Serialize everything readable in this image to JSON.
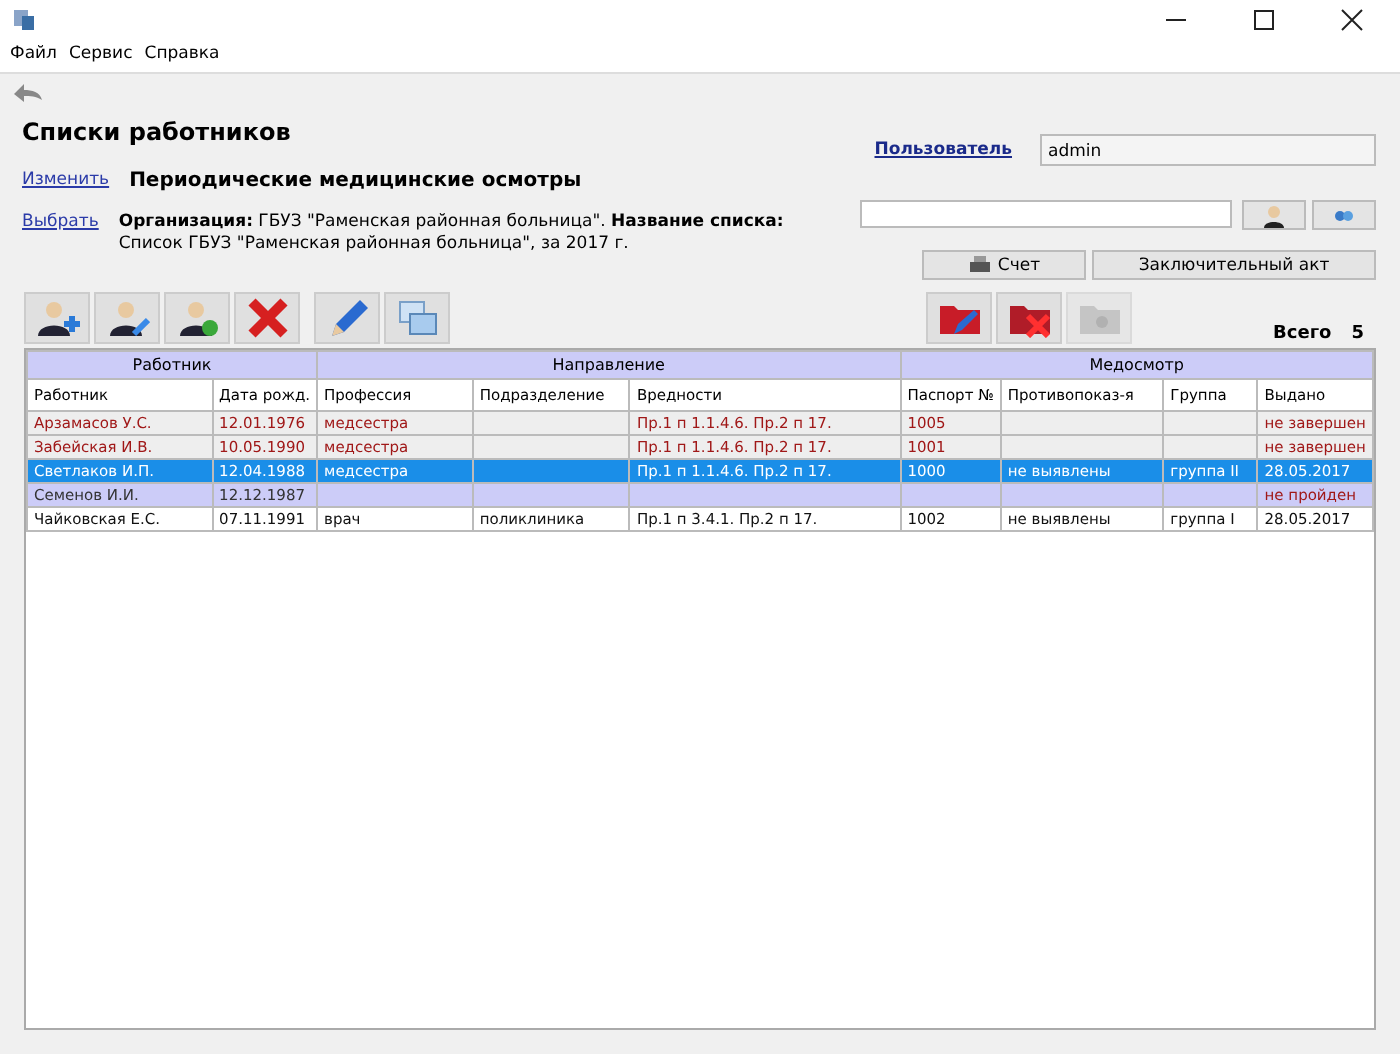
{
  "menu": [
    "Файл",
    "Сервис",
    "Справка"
  ],
  "heading": "Списки работников",
  "change_link": "Изменить",
  "list_title": "Периодические медицинские осмотры",
  "select_link": "Выбрать",
  "description": "**Организация:** ГБУЗ \"Раменская районная больница\". **Название списка:** Список ГБУЗ \"Раменская районная больница\", за 2017 г.",
  "user_link": "Пользователь",
  "user_value": "admin",
  "invoice_button": "Счет",
  "final_act_button": "Заключительный акт",
  "total_label": "Всего",
  "total_value": "5",
  "table": {
    "groups": [
      "Работник",
      "Направление",
      "Медосмотр"
    ],
    "columns": [
      "Работник",
      "Дата рожд.",
      "Профессия",
      "Подразделение",
      "Вредности",
      "Паспорт №",
      "Противопоказ-я",
      "Группа",
      "Выдано"
    ],
    "rows": [
      {
        "kind": "unfinished",
        "selected": false,
        "cells": [
          "Арзамасов У.С.",
          "12.01.1976",
          "медсестра",
          "",
          "Пр.1 п 1.1.4.6. Пр.2 п 17.",
          "1005",
          "",
          "",
          "не завершен"
        ]
      },
      {
        "kind": "unfinished",
        "selected": false,
        "cells": [
          "Забейская И.В.",
          "10.05.1990",
          "медсестра",
          "",
          "Пр.1 п 1.1.4.6. Пр.2 п 17.",
          "1001",
          "",
          "",
          "не завершен"
        ]
      },
      {
        "kind": "done",
        "selected": true,
        "cells": [
          "Светлаков И.П.",
          "12.04.1988",
          "медсестра",
          "",
          "Пр.1 п 1.1.4.6. Пр.2 п 17.",
          "1000",
          "не выявлены",
          "группа II",
          "28.05.2017"
        ]
      },
      {
        "kind": "not_passed",
        "selected": false,
        "cells": [
          "Семенов И.И.",
          "12.12.1987",
          "",
          "",
          "",
          "",
          "",
          "",
          "не пройден"
        ]
      },
      {
        "kind": "done",
        "selected": false,
        "cells": [
          "Чайковская Е.С.",
          "07.11.1991",
          "врач",
          "поликлиника",
          "Пр.1 п 3.4.1. Пр.2 п 17.",
          "1002",
          "не выявлены",
          "группа I",
          "28.05.2017"
        ]
      }
    ]
  }
}
